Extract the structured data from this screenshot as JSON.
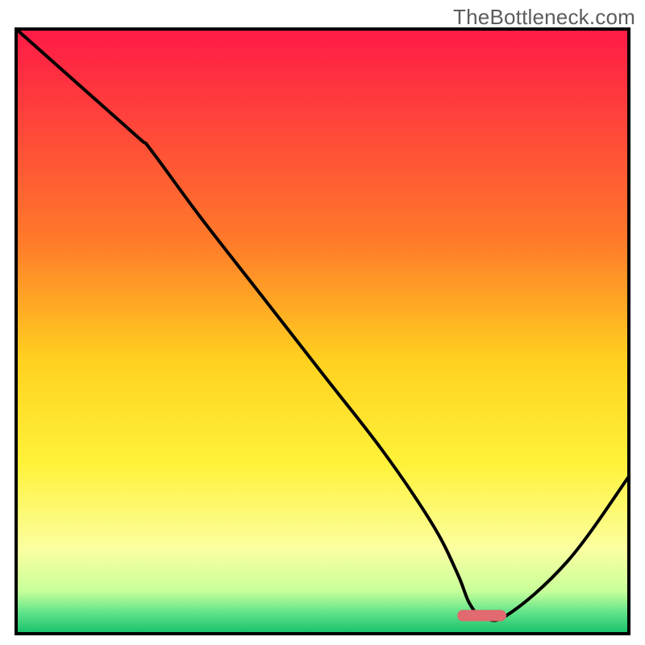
{
  "watermark": "TheBottleneck.com",
  "chart_data": {
    "type": "line",
    "title": "",
    "xlabel": "",
    "ylabel": "",
    "xlim": [
      0,
      100
    ],
    "ylim": [
      0,
      100
    ],
    "x": [
      0,
      10,
      20,
      22,
      30,
      40,
      50,
      60,
      68,
      72,
      74,
      76,
      80,
      90,
      100
    ],
    "values": [
      100,
      91,
      82,
      80,
      69,
      56,
      43,
      30,
      18,
      10,
      5,
      3,
      3,
      12,
      26
    ],
    "marker": {
      "x_range": [
        72,
        80
      ],
      "y": 3
    },
    "gradient_stops": [
      {
        "offset": 0.0,
        "color": "#ff1a47"
      },
      {
        "offset": 0.35,
        "color": "#ff7a2a"
      },
      {
        "offset": 0.55,
        "color": "#ffd21f"
      },
      {
        "offset": 0.72,
        "color": "#fff23a"
      },
      {
        "offset": 0.86,
        "color": "#fbffa0"
      },
      {
        "offset": 0.93,
        "color": "#c7ff9a"
      },
      {
        "offset": 0.965,
        "color": "#5fe38a"
      },
      {
        "offset": 1.0,
        "color": "#16c06a"
      }
    ],
    "border_color": "#000000",
    "curve_color": "#000000",
    "marker_color": "#e06a6f"
  }
}
